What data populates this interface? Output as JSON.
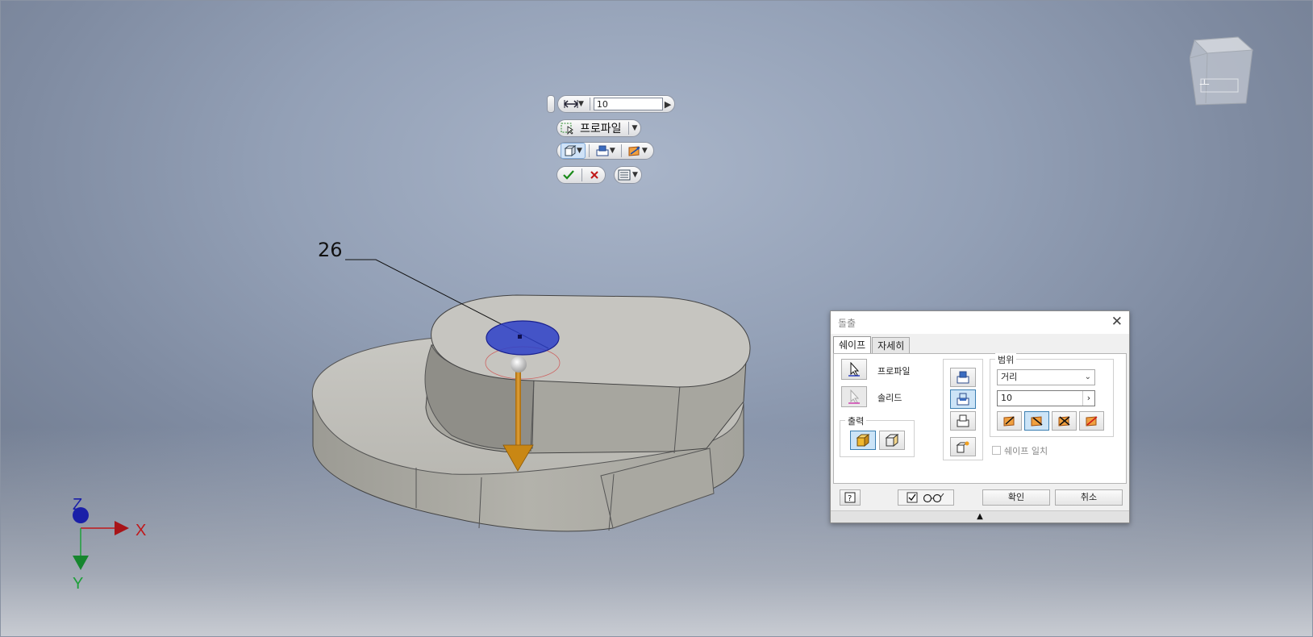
{
  "mini_toolbar": {
    "distance_value": "10",
    "profile_label": "프로파일"
  },
  "dimension": {
    "value": "26"
  },
  "dialog": {
    "title": "돌출",
    "tabs": [
      {
        "label": "쉐이프"
      },
      {
        "label": "자세히"
      }
    ],
    "profile_label": "프로파일",
    "solid_label": "솔리드",
    "output_label": "출력",
    "extents_label": "범위",
    "extents_type": "거리",
    "distance_value": "10",
    "match_shape_label": "쉐이프 일치",
    "ok_label": "확인",
    "cancel_label": "취소"
  },
  "triad": {
    "x": "X",
    "y": "Y",
    "z": "Z"
  },
  "colors": {
    "accent_blue": "#3c7fb1",
    "axis_x": "#c0181b",
    "axis_y": "#1ea03a",
    "axis_z": "#1a1fa8",
    "arrow": "#c98714",
    "profile_fill": "#2d3fc8"
  }
}
